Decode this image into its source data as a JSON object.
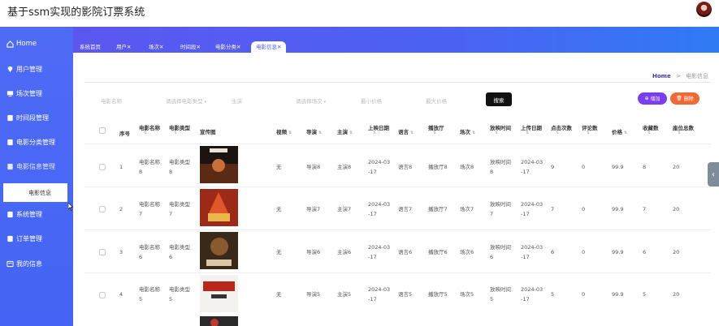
{
  "app": {
    "title": "基于ssm实现的影院订票系统"
  },
  "sidebar": {
    "items": [
      {
        "label": "Home",
        "icon": "home-icon"
      },
      {
        "label": "用户管理",
        "icon": "location-pin-icon"
      },
      {
        "label": "场次管理",
        "icon": "monitor-icon"
      },
      {
        "label": "时间段管理",
        "icon": "clipboard-icon"
      },
      {
        "label": "电影分类管理",
        "icon": "clipboard-icon"
      },
      {
        "label": "电影信息管理",
        "icon": "clipboard-icon"
      },
      {
        "label": "系统管理",
        "icon": "clipboard-icon"
      },
      {
        "label": "订单管理",
        "icon": "clipboard-icon"
      },
      {
        "label": "我的信息",
        "icon": "card-icon"
      }
    ],
    "sub_item": "电影信息"
  },
  "tabs": [
    {
      "label": "系统首页"
    },
    {
      "label": "用户✕"
    },
    {
      "label": "场次✕"
    },
    {
      "label": "时间段✕"
    },
    {
      "label": "电影分类✕"
    },
    {
      "label": "电影信息✕"
    }
  ],
  "breadcrumb": {
    "home": "Home",
    "sep": ">",
    "current": "电影信息"
  },
  "filters": [
    {
      "placeholder": "电影名称"
    },
    {
      "placeholder": "请选择电影类型"
    },
    {
      "placeholder": "主演"
    },
    {
      "placeholder": "请选择场次"
    },
    {
      "placeholder": "最小价格"
    },
    {
      "placeholder": "最大价格"
    }
  ],
  "buttons": {
    "search": "搜索",
    "add": "增加",
    "delete": "删除"
  },
  "table": {
    "headers": [
      "序号",
      "电影名称",
      "电影类型",
      "宣传图",
      "视频",
      "导演",
      "主演",
      "上映日期",
      "语言",
      "播放厅",
      "场次",
      "放映时间",
      "上传日期",
      "点击次数",
      "评论数",
      "价格",
      "收藏数",
      "座位总数"
    ],
    "rows": [
      {
        "no": "1",
        "name": "电影名称\n8",
        "type": "电影类型\n8",
        "video": "无",
        "director": "导演8",
        "actor": "主演8",
        "release": "2024-03\n-17",
        "lang": "语言8",
        "hall": "播放厅8",
        "session": "场次8",
        "showtime": "放映时间\n8",
        "upload": "2024-03\n-17",
        "clicks": "9",
        "comments": "0",
        "price": "99.9",
        "fav": "8",
        "seats": "20"
      },
      {
        "no": "2",
        "name": "电影名称\n7",
        "type": "电影类型\n7",
        "video": "无",
        "director": "导演7",
        "actor": "主演7",
        "release": "2024-03\n-17",
        "lang": "语言7",
        "hall": "播放厅7",
        "session": "场次7",
        "showtime": "放映时间\n7",
        "upload": "2024-03\n-17",
        "clicks": "7",
        "comments": "0",
        "price": "99.9",
        "fav": "7",
        "seats": "20"
      },
      {
        "no": "3",
        "name": "电影名称\n6",
        "type": "电影类型\n6",
        "video": "无",
        "director": "导演6",
        "actor": "主演6",
        "release": "2024-03\n-17",
        "lang": "语言6",
        "hall": "播放厅6",
        "session": "场次6",
        "showtime": "放映时间\n6",
        "upload": "2024-03\n-17",
        "clicks": "6",
        "comments": "0",
        "price": "99.9",
        "fav": "6",
        "seats": "20"
      },
      {
        "no": "4",
        "name": "电影名称\n5",
        "type": "电影类型\n5",
        "video": "无",
        "director": "导演5",
        "actor": "主演5",
        "release": "2024-03\n-17",
        "lang": "语言5",
        "hall": "播放厅5",
        "session": "场次5",
        "showtime": "放映时间\n5",
        "upload": "2024-03\n-17",
        "clicks": "5",
        "comments": "0",
        "price": "99.9",
        "fav": "5",
        "seats": "20"
      }
    ]
  },
  "colors": {
    "sidebar": "#4b63f3",
    "add_button": "#7b3df0",
    "delete_button": "#ef6a36",
    "search_button": "#111111"
  }
}
